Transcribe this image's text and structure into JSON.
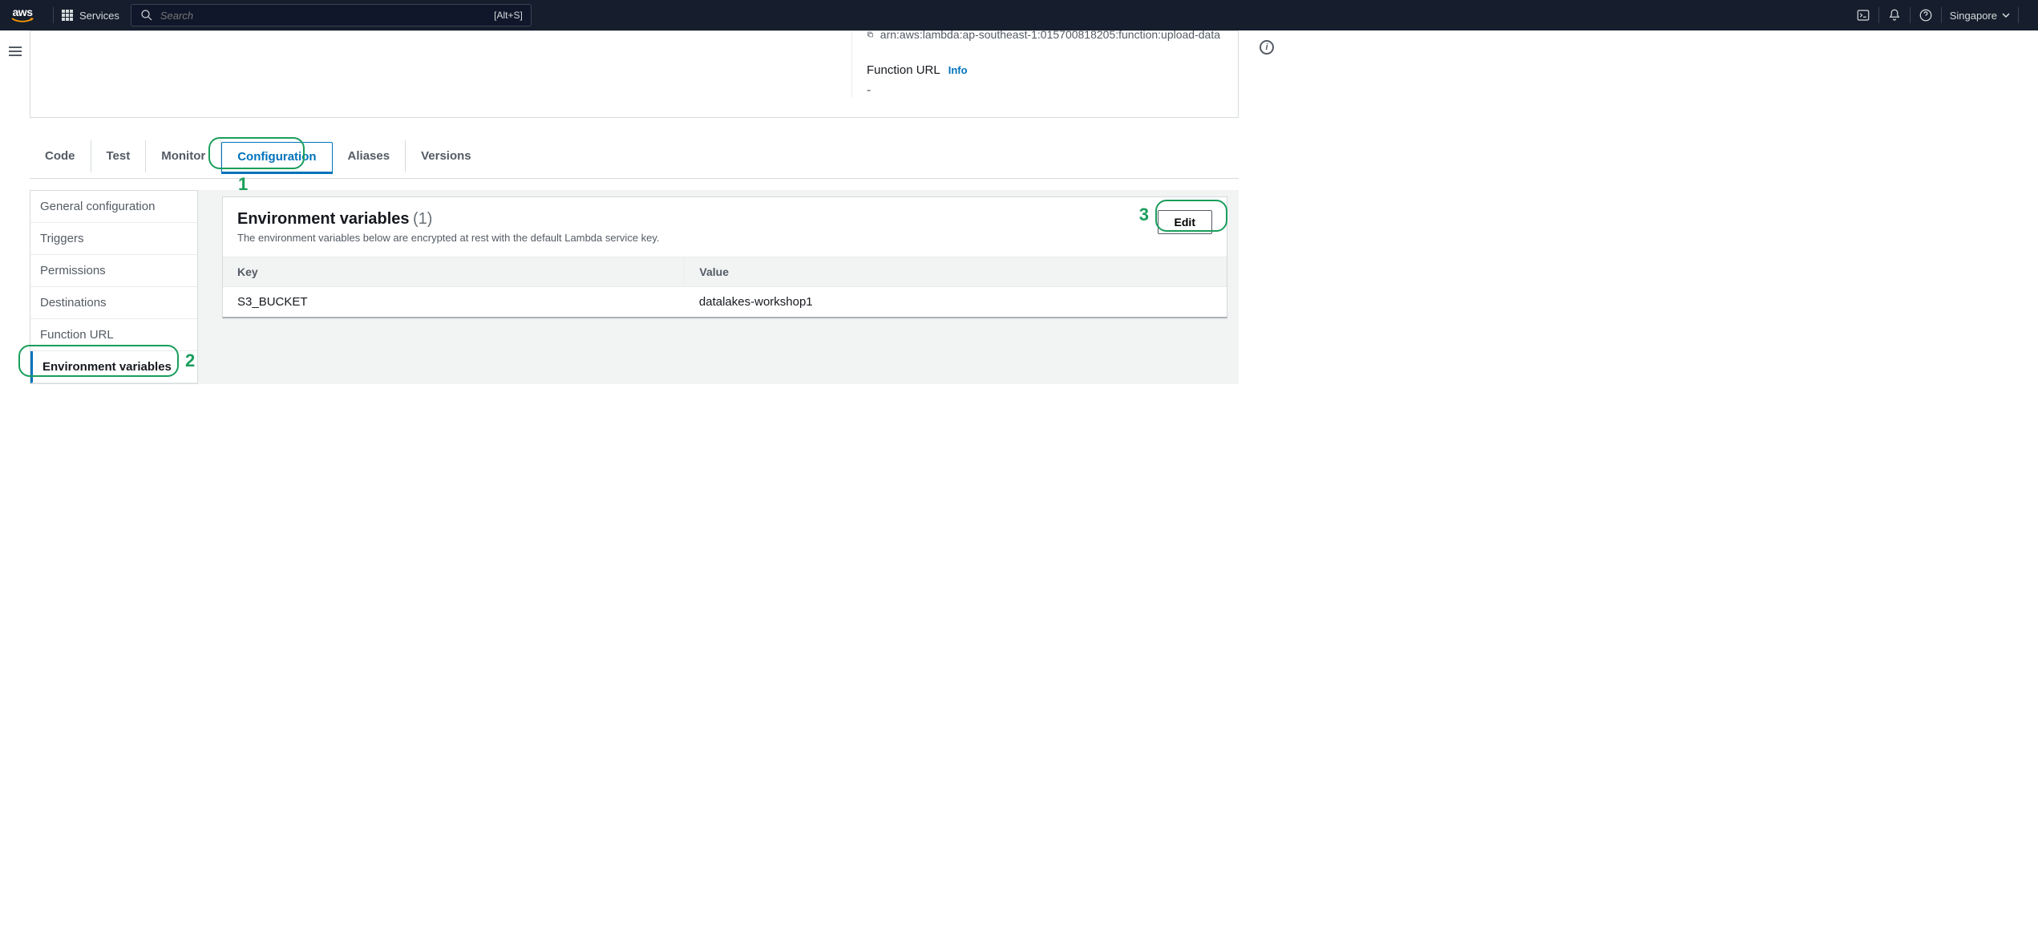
{
  "topnav": {
    "services_label": "Services",
    "search_placeholder": "Search",
    "search_shortcut": "[Alt+S]",
    "region": "Singapore"
  },
  "info_card": {
    "arn": "arn:aws:lambda:ap-southeast-1:015700818205:function:upload-data",
    "function_url_label": "Function URL",
    "info_link": "Info",
    "function_url_value": "-"
  },
  "tabs": {
    "code": "Code",
    "test": "Test",
    "monitor": "Monitor",
    "configuration": "Configuration",
    "aliases": "Aliases",
    "versions": "Versions"
  },
  "sidebar": {
    "items": [
      "General configuration",
      "Triggers",
      "Permissions",
      "Destinations",
      "Function URL",
      "Environment variables"
    ]
  },
  "panel": {
    "title": "Environment variables",
    "count": "(1)",
    "description": "The environment variables below are encrypted at rest with the default Lambda service key.",
    "edit_label": "Edit",
    "table": {
      "key_header": "Key",
      "value_header": "Value",
      "rows": [
        {
          "key": "S3_BUCKET",
          "value": "datalakes-workshop1"
        }
      ]
    }
  },
  "markers": {
    "one": "1",
    "two": "2",
    "three": "3"
  }
}
